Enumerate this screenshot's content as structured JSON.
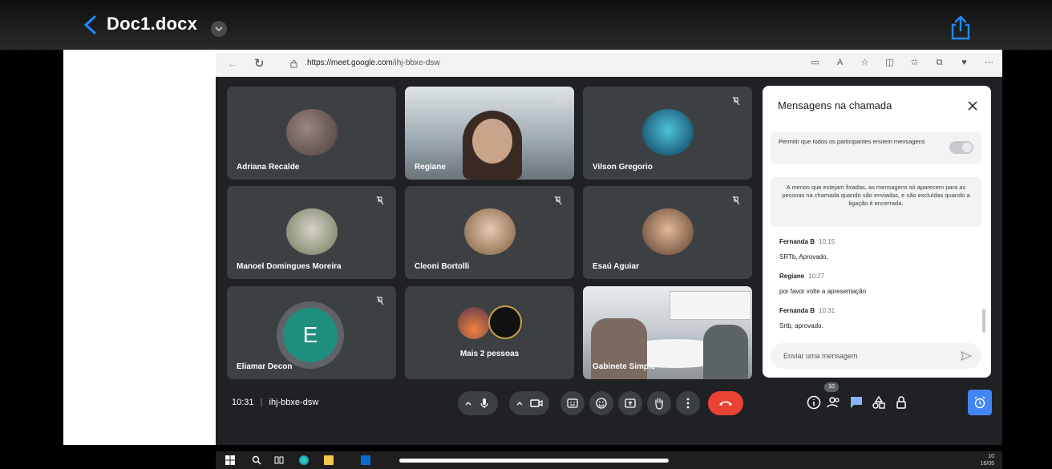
{
  "ios": {
    "doc_title": "Doc1.docx"
  },
  "browser": {
    "url_domain": "https://meet.google.com",
    "url_path": "/ihj-bbxe-dsw"
  },
  "tiles": [
    {
      "name": "Adriana Recalde"
    },
    {
      "name": "Regiane"
    },
    {
      "name": "Vilson Gregorio"
    },
    {
      "name": "Manoel Domingues Moreira"
    },
    {
      "name": "Cleoni Bortolli"
    },
    {
      "name": "Esaú Aguiar"
    },
    {
      "name": "Eliamar Decon",
      "initial": "E"
    },
    {
      "name": "Mais 2 pessoas"
    },
    {
      "name": "Gabinete Simple"
    }
  ],
  "chat": {
    "title": "Mensagens na chamada",
    "permission_text": "Permitir que todos os participantes enviem mensagens",
    "notice": "A menos que estejam fixadas, as mensagens só aparecem para as pessoas na chamada quando são enviadas, e são excluídas quando a ligação é encerrada.",
    "messages": [
      {
        "sender": "Fernanda B",
        "time": "10:15",
        "text": "SRTb, Aprovado."
      },
      {
        "sender": "Regiane",
        "time": "10:27",
        "text": "por favor volte a apresentação"
      },
      {
        "sender": "Fernanda B",
        "time": "10:31",
        "text": "Srtb, aprovado."
      }
    ],
    "input_placeholder": "Enviar uma mensagem"
  },
  "controls": {
    "time": "10:31",
    "separator": "|",
    "meeting_code": "ihj-bbxe-dsw",
    "participants_count": "10"
  },
  "taskbar": {
    "clock_line1": "10",
    "clock_line2": "16/05"
  },
  "colors": {
    "ios_blue": "#1a8cff",
    "meet_bg": "#202124",
    "tile_bg": "#3c4043",
    "end_call": "#ea4335",
    "accent_blue": "#4285f4"
  }
}
